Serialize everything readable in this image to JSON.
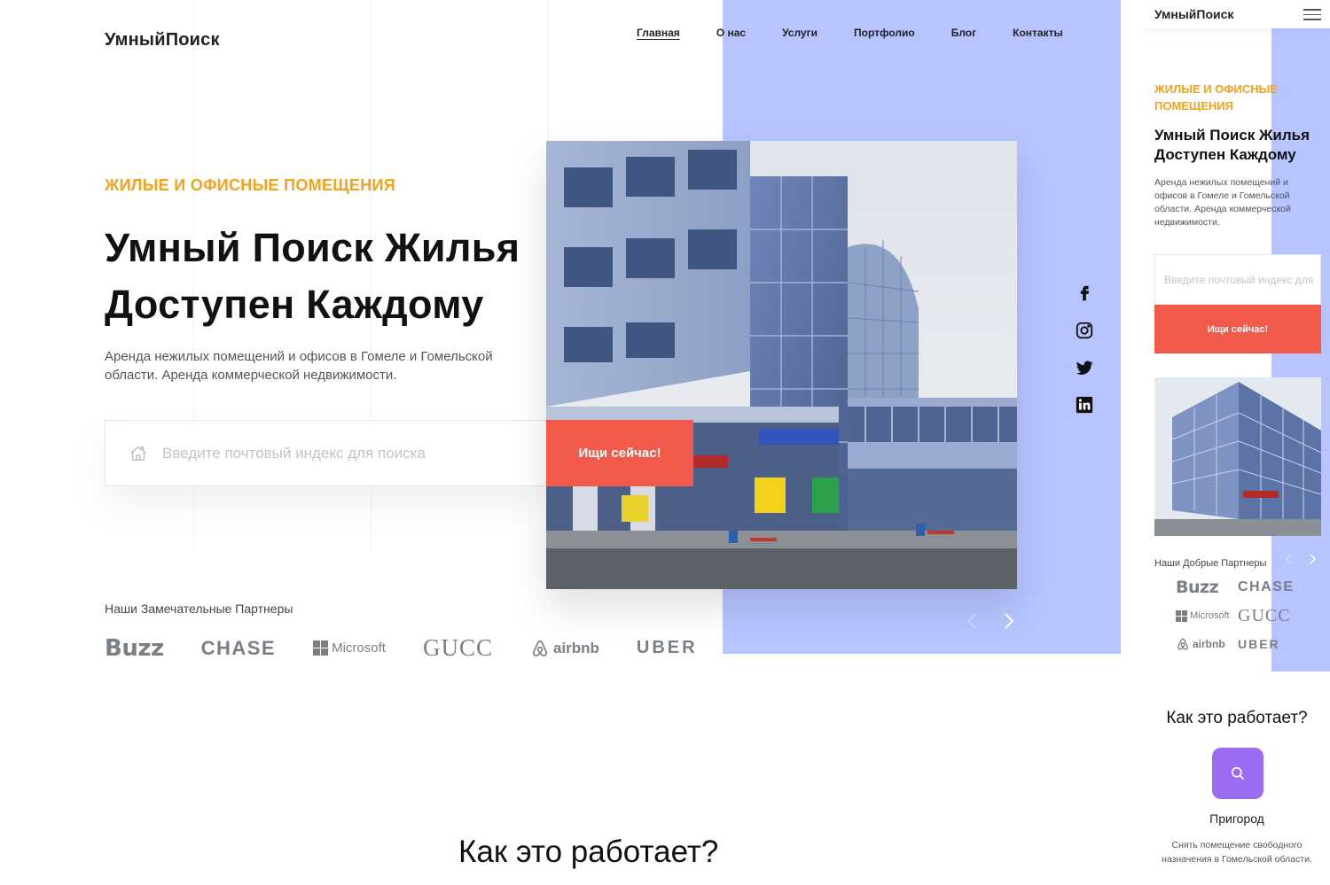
{
  "desktop": {
    "logo": "УмныйПоиск",
    "nav": [
      "Главная",
      "О нас",
      "Услуги",
      "Портфолио",
      "Блог",
      "Контакты"
    ],
    "eyebrow": "ЖИЛЫЕ И ОФИСНЫЕ ПОМЕЩЕНИЯ",
    "title_line1": "Умный Поиск Жилья",
    "title_line2": "Доступен Каждому",
    "description": "Аренда нежилых помещений и офисов в Гомеле и Гомельской области. Аренда коммерческой недвижимости.",
    "search_placeholder": "Введите почтовый индекс для поиска",
    "search_button": "Ищи сейчас!",
    "social_icons": [
      "facebook-icon",
      "instagram-icon",
      "twitter-icon",
      "linkedin-icon"
    ],
    "partners_label": "Наши Замечательные Партнеры",
    "partners": [
      "Buzz",
      "CHASE",
      "Microsoft",
      "GUCC",
      "airbnb",
      "UBER"
    ],
    "how_title": "Как это работает?"
  },
  "mobile": {
    "logo": "УмныйПоиск",
    "eyebrow": "ЖИЛЫЕ И ОФИСНЫЕ ПОМЕЩЕНИЯ",
    "title_line1": "Умный Поиск Жилья",
    "title_line2": "Доступен Каждому",
    "description": "Аренда нежилых помещений и офисов в Гомеле и Гомельской области. Аренда коммерческой недвижимости.",
    "search_placeholder": "Введите почтовый индекс для поиска",
    "search_button": "Ищи сейчас!",
    "partners_label": "Наши Добрые Партнеры",
    "partners": [
      "Buzz",
      "CHASE",
      "Microsoft",
      "GUCC",
      "airbnb",
      "UBER"
    ],
    "how_title": "Как это работает?",
    "step_title": "Пригород",
    "step_desc": "Снять помещение свободного назначения в Гомельской области."
  },
  "colors": {
    "accent_orange": "#f7a11a",
    "button_red": "#f15a4b",
    "panel_blue": "#b7c4ff",
    "tile_purple": "#9b6bf2"
  }
}
